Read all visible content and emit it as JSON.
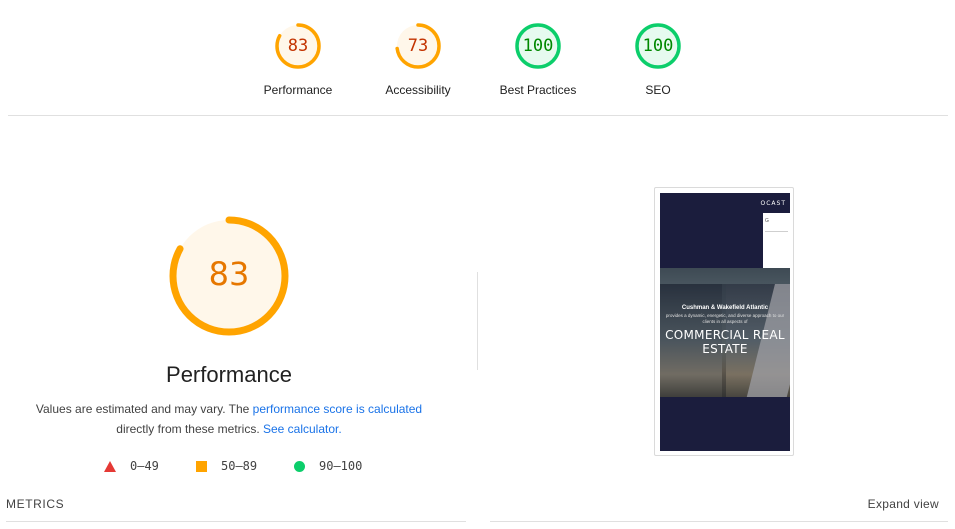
{
  "summary": {
    "gauges": [
      {
        "label": "Performance",
        "score": "83",
        "fraction": 0.83,
        "color": "#ffa400",
        "fill": "#fff7ea",
        "text_color": "#c33300"
      },
      {
        "label": "Accessibility",
        "score": "73",
        "fraction": 0.73,
        "color": "#ffa400",
        "fill": "#fff7ea",
        "text_color": "#c33300"
      },
      {
        "label": "Best Practices",
        "score": "100",
        "fraction": 1.0,
        "color": "#0cce6b",
        "fill": "#e6faef",
        "text_color": "#008800"
      },
      {
        "label": "SEO",
        "score": "100",
        "fraction": 1.0,
        "color": "#0cce6b",
        "fill": "#e6faef",
        "text_color": "#008800"
      }
    ]
  },
  "performance": {
    "score": "83",
    "fraction": 0.83,
    "color": "#ffa400",
    "fill": "#fff7ea",
    "title": "Performance",
    "desc_prefix": "Values are estimated and may vary. The ",
    "desc_link1": "performance score is calculated",
    "desc_middle": " directly from these metrics. ",
    "desc_link2": "See calculator.",
    "link_color": "#1a73e8"
  },
  "legend": {
    "fail": "0–49",
    "average": "50–89",
    "pass": "90–100",
    "fail_color": "#e53935",
    "average_color": "#ffa400",
    "pass_color": "#0cce6b"
  },
  "screenshot": {
    "logo_text": "OCAST",
    "white_text": "G",
    "subtitle": "Cushman & Wakefield Atlantic",
    "subtitle2": "provides a dynamic, energetic, and diverse approach to our clients in all aspects of",
    "title": "COMMERCIAL REAL ESTATE"
  },
  "metrics": {
    "title": "METRICS",
    "expand_label": "Expand view"
  }
}
